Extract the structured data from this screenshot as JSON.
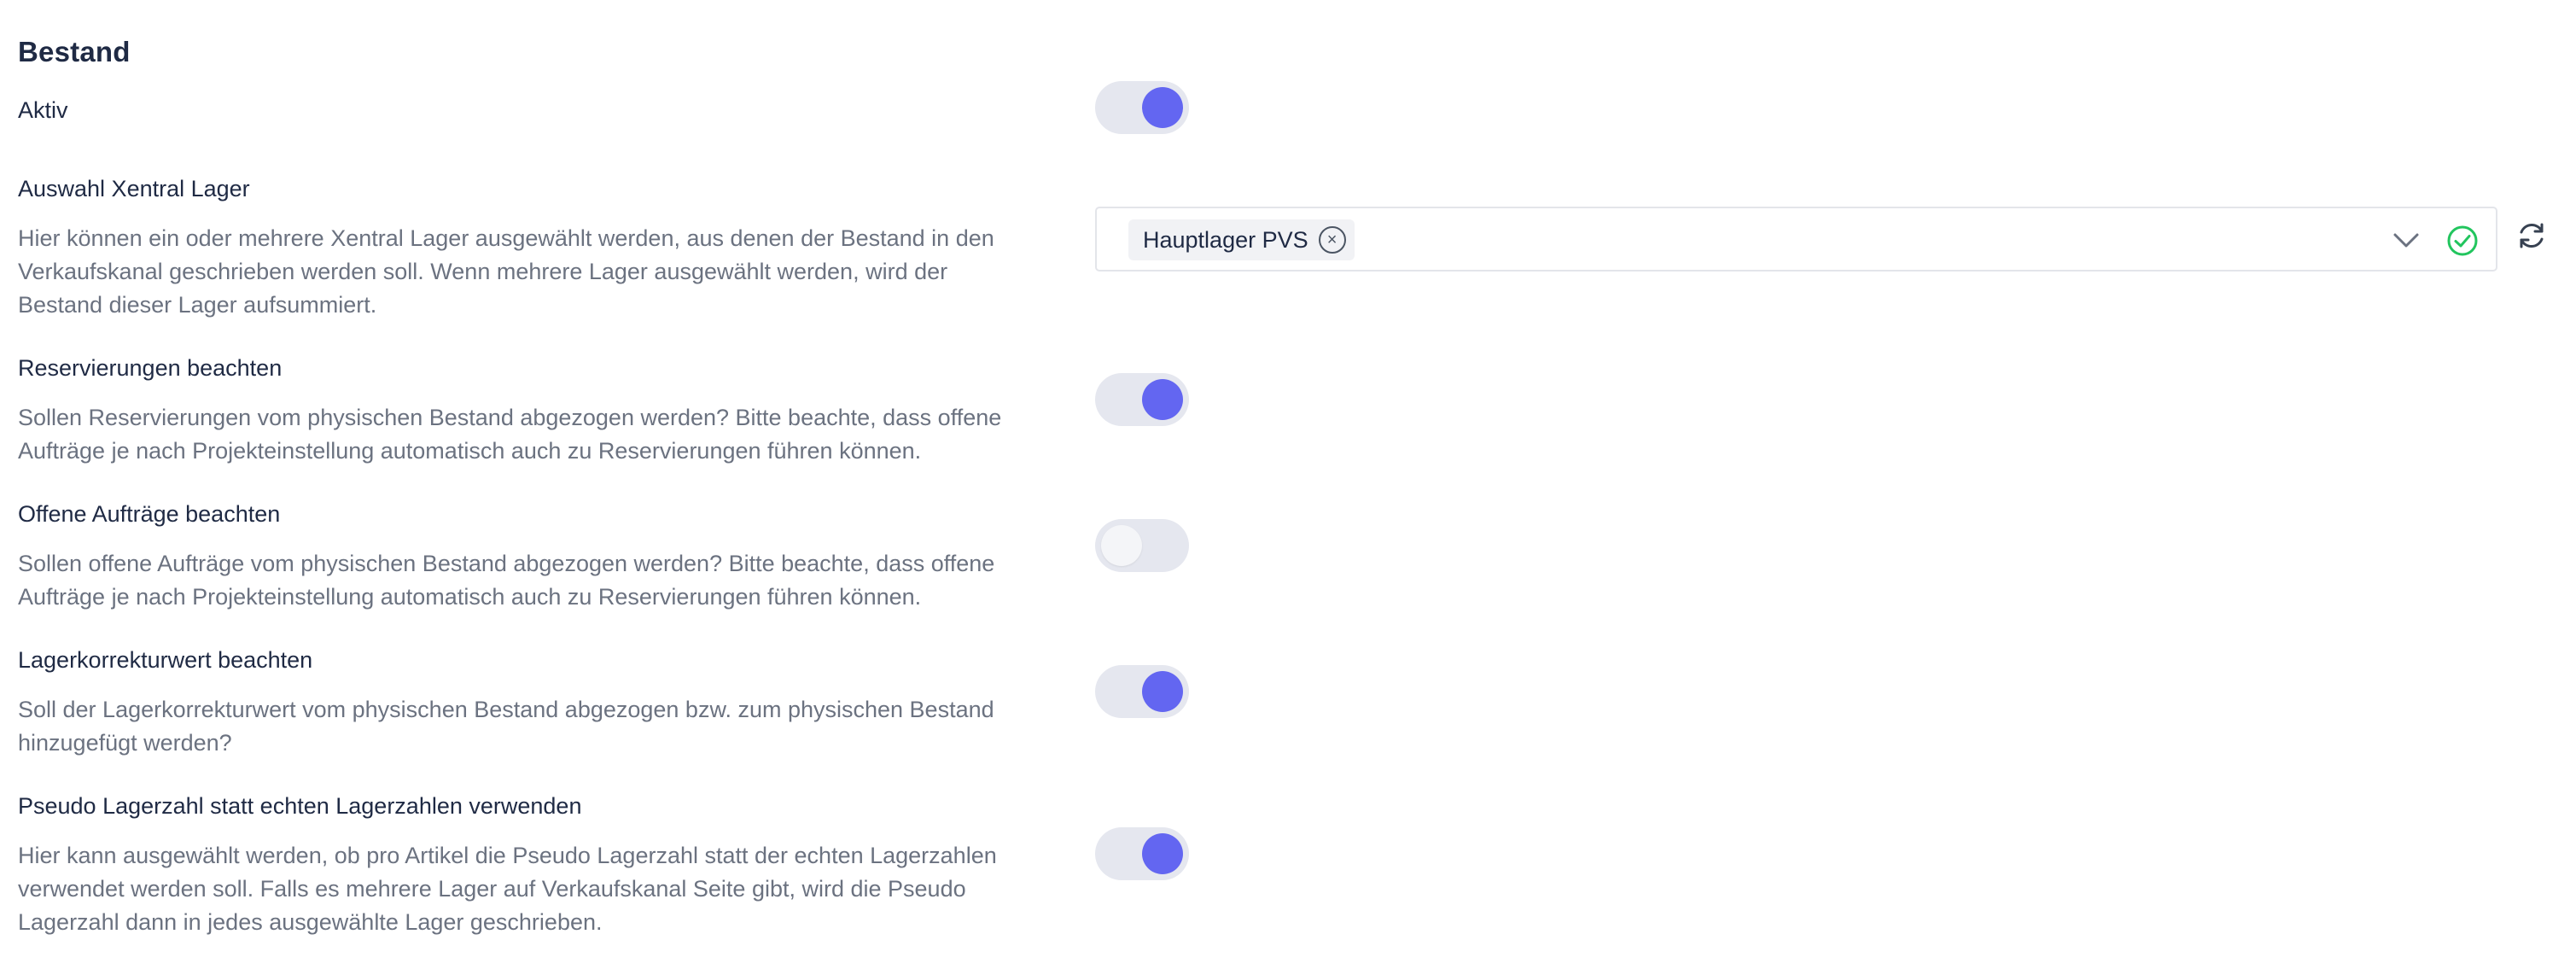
{
  "section": {
    "title": "Bestand"
  },
  "settings": [
    {
      "label": "Aktiv",
      "toggle": "on"
    },
    {
      "label": "Auswahl Xentral Lager",
      "description": [
        "Hier können ein oder mehrere Xentral Lager ausgewählt werden, aus denen der Bestand in den",
        "Verkaufskanal geschrieben werden soll. Wenn mehrere Lager ausgewählt werden, wird der",
        "Bestand dieser Lager aufsummiert."
      ],
      "select": {
        "selected": [
          "Hauptlager PVS"
        ],
        "status": "valid"
      }
    },
    {
      "label": "Reservierungen beachten",
      "description": [
        "Sollen Reservierungen vom physischen Bestand abgezogen werden? Bitte beachte, dass offene",
        "Aufträge je nach Projekteinstellung automatisch auch zu Reservierungen führen können."
      ],
      "toggle": "on"
    },
    {
      "label": "Offene Aufträge beachten",
      "description": [
        "Sollen offene Aufträge vom physischen Bestand abgezogen werden? Bitte beachte, dass offene",
        "Aufträge je nach Projekteinstellung automatisch auch zu Reservierungen führen können."
      ],
      "toggle": "off"
    },
    {
      "label": "Lagerkorrekturwert beachten",
      "description": [
        "Soll der Lagerkorrekturwert vom physischen Bestand abgezogen bzw. zum physischen Bestand",
        "hinzugefügt werden?"
      ],
      "toggle": "on"
    },
    {
      "label": "Pseudo Lagerzahl statt echten Lagerzahlen verwenden",
      "description": [
        "Hier kann ausgewählt werden, ob pro Artikel die Pseudo Lagerzahl statt der echten Lagerzahlen",
        "verwendet werden soll. Falls es mehrere Lager auf Verkaufskanal Seite gibt, wird die Pseudo",
        "Lagerzahl dann in jedes ausgewählte Lager geschrieben."
      ],
      "toggle": "on"
    }
  ],
  "icons": {
    "chip_remove": "close-circle-icon",
    "dropdown": "chevron-down-icon",
    "valid": "check-circle-icon",
    "refresh": "refresh-icon"
  },
  "colors": {
    "toggle_on": "#6366f1",
    "toggle_track": "#e5e7ef",
    "valid": "#22c55e"
  }
}
